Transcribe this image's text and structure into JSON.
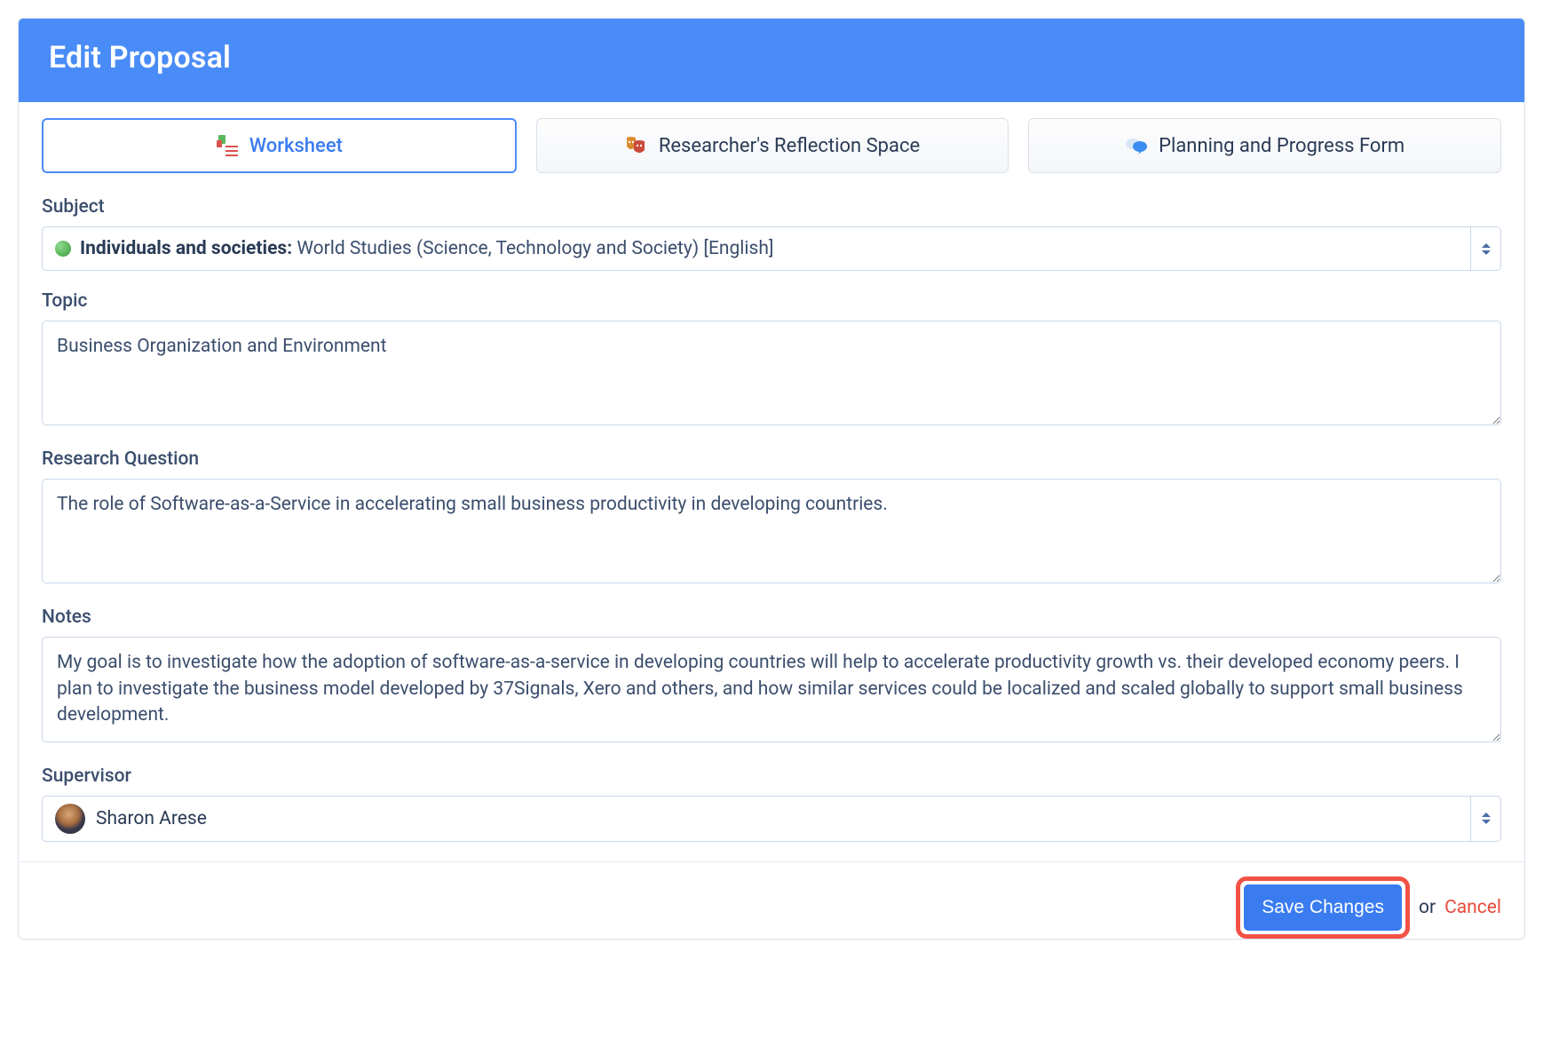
{
  "header": {
    "title": "Edit Proposal"
  },
  "tabs": {
    "worksheet": "Worksheet",
    "reflection": "Researcher's Reflection Space",
    "planning": "Planning and Progress Form"
  },
  "fields": {
    "subject": {
      "label": "Subject",
      "category": "Individuals and societies:",
      "detail": "World Studies (Science, Technology and Society) [English]"
    },
    "topic": {
      "label": "Topic",
      "value": "Business Organization and Environment"
    },
    "research_question": {
      "label": "Research Question",
      "value": "The role of Software-as-a-Service in accelerating small business productivity in developing countries."
    },
    "notes": {
      "label": "Notes",
      "value": "My goal is to investigate how the adoption of software-as-a-service in developing countries will help to accelerate productivity growth vs. their developed economy peers. I plan to investigate the business model developed by 37Signals, Xero and others, and how similar services could be localized and scaled globally to support small business development."
    },
    "supervisor": {
      "label": "Supervisor",
      "name": "Sharon Arese"
    }
  },
  "footer": {
    "save": "Save Changes",
    "or": "or",
    "cancel": "Cancel"
  }
}
